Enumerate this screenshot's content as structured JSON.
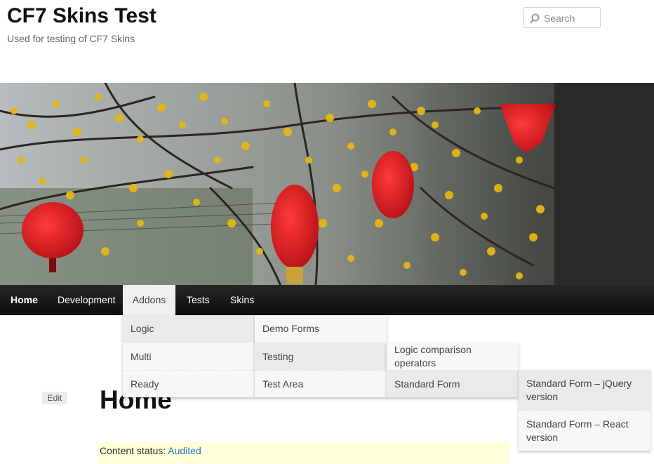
{
  "site": {
    "title": "CF7 Skins Test",
    "description": "Used for testing of CF7 Skins"
  },
  "search": {
    "placeholder": "Search"
  },
  "nav": {
    "items": [
      "Home",
      "Development",
      "Addons",
      "Tests",
      "Skins"
    ],
    "active": "Addons"
  },
  "menu": {
    "level1": [
      "Logic",
      "Multi",
      "Ready"
    ],
    "level2": [
      "Demo Forms",
      "Testing",
      "Test Area"
    ],
    "level3": [
      "Logic comparison operators",
      "Standard Form"
    ],
    "level4": [
      "Standard Form – jQuery version",
      "Standard Form – React version"
    ]
  },
  "page": {
    "edit_label": "Edit",
    "title": "Home",
    "status_label": "Content status:",
    "status_value": "Audited"
  },
  "colors": {
    "link": "#2173c9",
    "navbar": "#1a1a1a",
    "status_bg": "#ffffd9"
  }
}
